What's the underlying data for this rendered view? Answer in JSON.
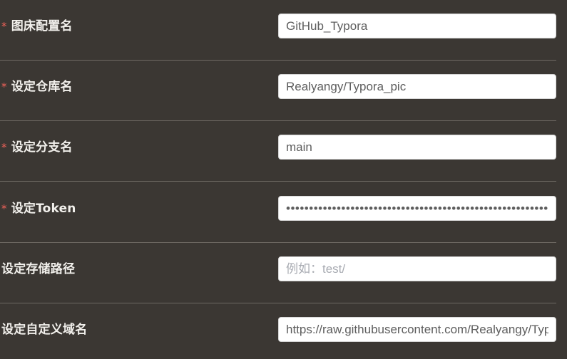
{
  "fields": [
    {
      "label": "图床配置名",
      "required": true,
      "value": "GitHub_Typora",
      "placeholder": "",
      "type": "text"
    },
    {
      "label": "设定仓库名",
      "required": true,
      "value": "Realyangy/Typora_pic",
      "placeholder": "",
      "type": "text"
    },
    {
      "label": "设定分支名",
      "required": true,
      "value": "main",
      "placeholder": "",
      "type": "text"
    },
    {
      "label": "设定Token",
      "required": true,
      "value": "ghp_xxxxxxxxxxxxxxxxxxxxxxxxxxxxxxxxxxxxxxxxxxxxxxxxxxxxxxxxxxxx",
      "placeholder": "",
      "type": "password"
    },
    {
      "label": "设定存储路径",
      "required": false,
      "value": "",
      "placeholder": "例如：test/",
      "type": "text"
    },
    {
      "label": "设定自定义域名",
      "required": false,
      "value": "https://raw.githubusercontent.com/Realyangy/Typora_pic/main",
      "placeholder": "",
      "type": "text"
    }
  ],
  "required_mark": "*",
  "colors": {
    "background": "#3b3733",
    "label": "#f2f0ec",
    "required": "#f0625a",
    "divider": "#6e6963",
    "input_bg": "#ffffff",
    "input_text": "#5d5d5d",
    "placeholder": "#a8abb2"
  }
}
